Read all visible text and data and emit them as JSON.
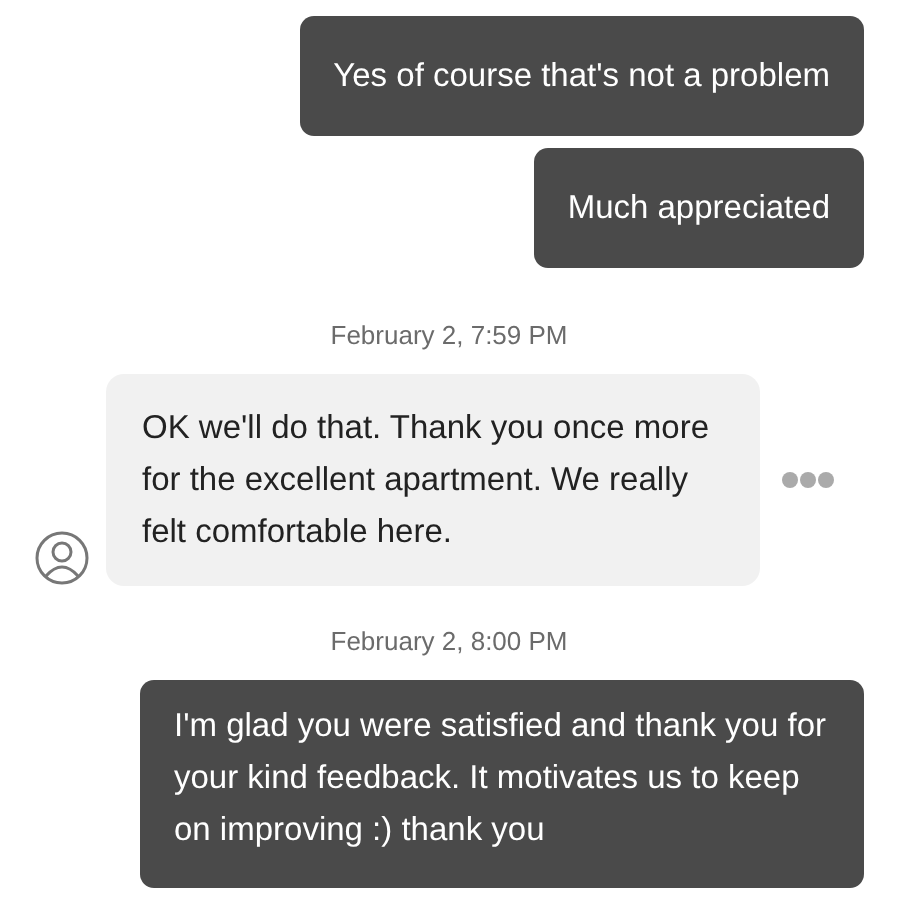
{
  "messages": [
    {
      "kind": "sent",
      "text": "Yes of course that's not a problem"
    },
    {
      "kind": "sent",
      "text": "Much appreciated"
    },
    {
      "kind": "timestamp",
      "text": "February 2, 7:59 PM"
    },
    {
      "kind": "received",
      "text": "OK we'll do that. Thank you once more for the excellent apartment. We really felt comfortable here."
    },
    {
      "kind": "timestamp",
      "text": "February 2, 8:00 PM"
    },
    {
      "kind": "sent",
      "text": "I'm glad you were satisfied and thank you for your kind feedback. It motivates us to keep on improving :) thank you"
    }
  ]
}
